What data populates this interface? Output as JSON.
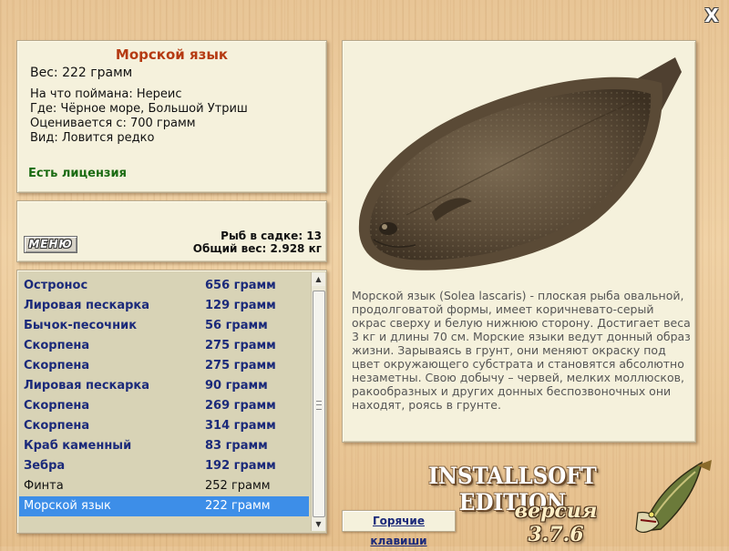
{
  "window": {
    "close_label": "X"
  },
  "fish_info": {
    "title": "Морской язык",
    "weight": "Вес: 222 грамм",
    "bait": "На что поймана: Нереис",
    "location": "Где: Чёрное море, Большой Утриш",
    "value": "Оценивается с: 700 грамм",
    "rarity": "Вид: Ловится редко",
    "license": "Есть лицензия"
  },
  "stats": {
    "menu_label": "МЕНЮ",
    "fish_in_keepnet": "Рыб в садке: 13",
    "total_weight": "Общий вес: 2.928 кг"
  },
  "catch_list": [
    {
      "name": "Остронос",
      "weight": "656 грамм",
      "style": "bold"
    },
    {
      "name": "Лировая пескарка",
      "weight": "129 грамм",
      "style": "bold"
    },
    {
      "name": "Бычок-песочник",
      "weight": "56 грамм",
      "style": "bold"
    },
    {
      "name": "Скорпена",
      "weight": "275 грамм",
      "style": "bold"
    },
    {
      "name": "Скорпена",
      "weight": "275 грамм",
      "style": "bold"
    },
    {
      "name": "Лировая пескарка",
      "weight": "90 грамм",
      "style": "bold"
    },
    {
      "name": "Скорпена",
      "weight": "269 грамм",
      "style": "bold"
    },
    {
      "name": "Скорпена",
      "weight": "314 грамм",
      "style": "bold"
    },
    {
      "name": "Краб каменный",
      "weight": "83 грамм",
      "style": "bold"
    },
    {
      "name": "Зебра",
      "weight": "192 грамм",
      "style": "bold"
    },
    {
      "name": "Финта",
      "weight": "252 грамм",
      "style": "normal"
    },
    {
      "name": "Морской язык",
      "weight": "222 грамм",
      "style": "selected"
    }
  ],
  "description": "Морской язык (Solea lascaris) - плоская рыба овальной, продолговатой формы, имеет коричневато-серый окрас сверху и белую нижнюю сторону. Достигает веса 3 кг и длины 70 см. Морские языки ведут донный образ жизни. Зарываясь в грунт, они меняют окраску под цвет окружающего субстрата и становятся абсолютно незаметны. Свою добычу – червей, мелких моллюсков, ракообразных и других донных беспозвоночных они находят, роясь в грунте.",
  "hotkeys_label": "Горячие клавиши",
  "brand": {
    "edition": "INSTALLSOFT EDITION",
    "version": "версия 3.7.6"
  },
  "colors": {
    "title_red": "#b53a12",
    "list_blue": "#1b2a7a",
    "license_green": "#1a6b12",
    "selection_blue": "#3d8ee8"
  }
}
